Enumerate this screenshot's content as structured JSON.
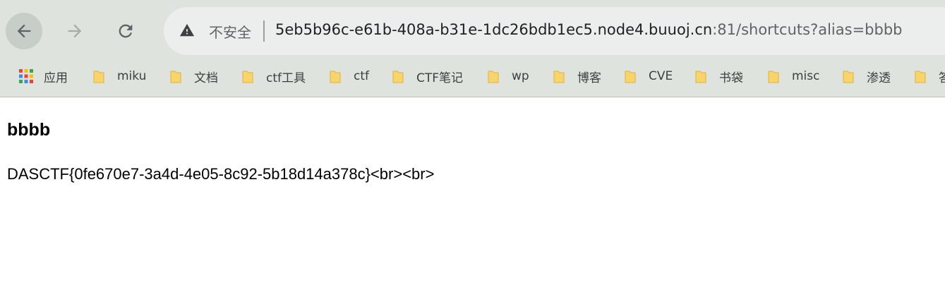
{
  "toolbar": {
    "insecure_label": "不安全",
    "url_host": "5eb5b96c-e61b-408a-b31e-1dc26bdb1ec5.node4.buuoj.cn",
    "url_rest": ":81/shortcuts?alias=bbbb"
  },
  "bookmarks": [
    {
      "label": "应用",
      "icon": "apps-grid-icon"
    },
    {
      "label": "miku",
      "icon": "folder-icon"
    },
    {
      "label": "文档",
      "icon": "folder-icon"
    },
    {
      "label": "ctf工具",
      "icon": "folder-icon"
    },
    {
      "label": "ctf",
      "icon": "folder-icon"
    },
    {
      "label": "CTF笔记",
      "icon": "folder-icon"
    },
    {
      "label": "wp",
      "icon": "folder-icon"
    },
    {
      "label": "博客",
      "icon": "folder-icon"
    },
    {
      "label": "CVE",
      "icon": "folder-icon"
    },
    {
      "label": "书袋",
      "icon": "folder-icon"
    },
    {
      "label": "misc",
      "icon": "folder-icon"
    },
    {
      "label": "渗透",
      "icon": "folder-icon"
    },
    {
      "label": "答",
      "icon": "folder-icon"
    }
  ],
  "page": {
    "heading": "bbbb",
    "body_text": "DASCTF{0fe670e7-3a4d-4e05-8c92-5b18d14a378c}<br><br>"
  },
  "colors": {
    "chrome_bg": "#dee3dd",
    "omnibox_bg": "#eceeed",
    "folder_yellow": "#f7d56b"
  }
}
